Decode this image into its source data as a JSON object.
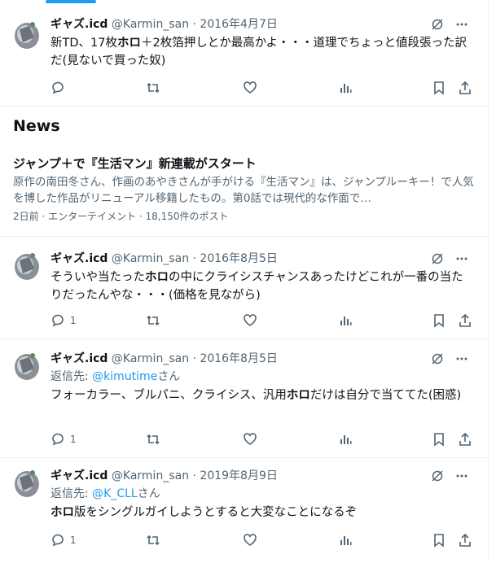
{
  "colors": {
    "accent": "#1d9bf0",
    "muted": "#536471",
    "text": "#0f1419",
    "divider": "#eff3f4"
  },
  "icons": [
    "grok-icon",
    "more-icon",
    "reply-icon",
    "retweet-icon",
    "like-icon",
    "views-icon",
    "bookmark-icon",
    "share-icon"
  ],
  "tweets": [
    {
      "name": "ギャズ.icd",
      "handle": "@Karmin_san",
      "sep": "·",
      "date": "2016年4月7日",
      "text_parts": [
        "新TD、17枚",
        "ホロ",
        "＋2枚箔押しとか最高かよ・・・道理でちょっと値段張った訳だ(見ないで買った奴)"
      ],
      "reply_count": ""
    },
    {
      "name": "ギャズ.icd",
      "handle": "@Karmin_san",
      "sep": "·",
      "date": "2016年8月5日",
      "text_parts": [
        "そういや当たった",
        "ホロ",
        "の中にクライシスチャンスあったけどこれが一番の当たりだったんやな・・・(価格を見ながら)"
      ],
      "reply_count": "1"
    },
    {
      "name": "ギャズ.icd",
      "handle": "@Karmin_san",
      "sep": "·",
      "date": "2016年8月5日",
      "reply_label": "返信先: ",
      "reply_user": "@kimutime",
      "reply_suffix": "さん",
      "text_parts": [
        "フォーカラー、ブルパニ、クライシス、汎用",
        "ホロ",
        "だけは自分で当ててた(困惑)"
      ],
      "reply_count": "1"
    },
    {
      "name": "ギャズ.icd",
      "handle": "@Karmin_san",
      "sep": "·",
      "date": "2019年8月9日",
      "reply_label": "返信先: ",
      "reply_user": "@K_CLL",
      "reply_suffix": "さん",
      "text_parts": [
        "",
        "ホロ",
        "版をシングルガイしようとすると大変なことになるぞ"
      ],
      "reply_count": "1"
    }
  ],
  "news": {
    "heading": "News",
    "title": "ジャンプ＋で『生活マン』新連載がスタート",
    "description": "原作の南田冬さん、作画のあやきさんが手がける『生活マン』は、ジャンプルーキー！で人気を博した作品がリニューアル移籍したもの。第0話では現代的な作面で…",
    "meta": "2日前 · エンターテイメント · 18,150件のポスト"
  }
}
